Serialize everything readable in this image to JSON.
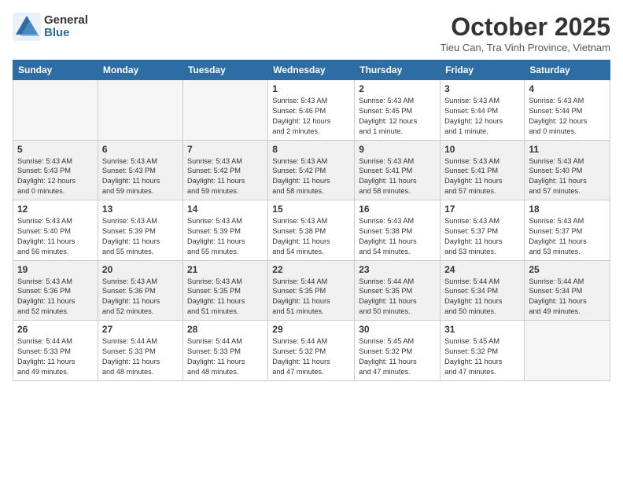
{
  "logo": {
    "general": "General",
    "blue": "Blue"
  },
  "title": "October 2025",
  "location": "Tieu Can, Tra Vinh Province, Vietnam",
  "days_header": [
    "Sunday",
    "Monday",
    "Tuesday",
    "Wednesday",
    "Thursday",
    "Friday",
    "Saturday"
  ],
  "weeks": [
    [
      {
        "num": "",
        "info": ""
      },
      {
        "num": "",
        "info": ""
      },
      {
        "num": "",
        "info": ""
      },
      {
        "num": "1",
        "info": "Sunrise: 5:43 AM\nSunset: 5:46 PM\nDaylight: 12 hours\nand 2 minutes."
      },
      {
        "num": "2",
        "info": "Sunrise: 5:43 AM\nSunset: 5:45 PM\nDaylight: 12 hours\nand 1 minute."
      },
      {
        "num": "3",
        "info": "Sunrise: 5:43 AM\nSunset: 5:44 PM\nDaylight: 12 hours\nand 1 minute."
      },
      {
        "num": "4",
        "info": "Sunrise: 5:43 AM\nSunset: 5:44 PM\nDaylight: 12 hours\nand 0 minutes."
      }
    ],
    [
      {
        "num": "5",
        "info": "Sunrise: 5:43 AM\nSunset: 5:43 PM\nDaylight: 12 hours\nand 0 minutes."
      },
      {
        "num": "6",
        "info": "Sunrise: 5:43 AM\nSunset: 5:43 PM\nDaylight: 11 hours\nand 59 minutes."
      },
      {
        "num": "7",
        "info": "Sunrise: 5:43 AM\nSunset: 5:42 PM\nDaylight: 11 hours\nand 59 minutes."
      },
      {
        "num": "8",
        "info": "Sunrise: 5:43 AM\nSunset: 5:42 PM\nDaylight: 11 hours\nand 58 minutes."
      },
      {
        "num": "9",
        "info": "Sunrise: 5:43 AM\nSunset: 5:41 PM\nDaylight: 11 hours\nand 58 minutes."
      },
      {
        "num": "10",
        "info": "Sunrise: 5:43 AM\nSunset: 5:41 PM\nDaylight: 11 hours\nand 57 minutes."
      },
      {
        "num": "11",
        "info": "Sunrise: 5:43 AM\nSunset: 5:40 PM\nDaylight: 11 hours\nand 57 minutes."
      }
    ],
    [
      {
        "num": "12",
        "info": "Sunrise: 5:43 AM\nSunset: 5:40 PM\nDaylight: 11 hours\nand 56 minutes."
      },
      {
        "num": "13",
        "info": "Sunrise: 5:43 AM\nSunset: 5:39 PM\nDaylight: 11 hours\nand 55 minutes."
      },
      {
        "num": "14",
        "info": "Sunrise: 5:43 AM\nSunset: 5:39 PM\nDaylight: 11 hours\nand 55 minutes."
      },
      {
        "num": "15",
        "info": "Sunrise: 5:43 AM\nSunset: 5:38 PM\nDaylight: 11 hours\nand 54 minutes."
      },
      {
        "num": "16",
        "info": "Sunrise: 5:43 AM\nSunset: 5:38 PM\nDaylight: 11 hours\nand 54 minutes."
      },
      {
        "num": "17",
        "info": "Sunrise: 5:43 AM\nSunset: 5:37 PM\nDaylight: 11 hours\nand 53 minutes."
      },
      {
        "num": "18",
        "info": "Sunrise: 5:43 AM\nSunset: 5:37 PM\nDaylight: 11 hours\nand 53 minutes."
      }
    ],
    [
      {
        "num": "19",
        "info": "Sunrise: 5:43 AM\nSunset: 5:36 PM\nDaylight: 11 hours\nand 52 minutes."
      },
      {
        "num": "20",
        "info": "Sunrise: 5:43 AM\nSunset: 5:36 PM\nDaylight: 11 hours\nand 52 minutes."
      },
      {
        "num": "21",
        "info": "Sunrise: 5:43 AM\nSunset: 5:35 PM\nDaylight: 11 hours\nand 51 minutes."
      },
      {
        "num": "22",
        "info": "Sunrise: 5:44 AM\nSunset: 5:35 PM\nDaylight: 11 hours\nand 51 minutes."
      },
      {
        "num": "23",
        "info": "Sunrise: 5:44 AM\nSunset: 5:35 PM\nDaylight: 11 hours\nand 50 minutes."
      },
      {
        "num": "24",
        "info": "Sunrise: 5:44 AM\nSunset: 5:34 PM\nDaylight: 11 hours\nand 50 minutes."
      },
      {
        "num": "25",
        "info": "Sunrise: 5:44 AM\nSunset: 5:34 PM\nDaylight: 11 hours\nand 49 minutes."
      }
    ],
    [
      {
        "num": "26",
        "info": "Sunrise: 5:44 AM\nSunset: 5:33 PM\nDaylight: 11 hours\nand 49 minutes."
      },
      {
        "num": "27",
        "info": "Sunrise: 5:44 AM\nSunset: 5:33 PM\nDaylight: 11 hours\nand 48 minutes."
      },
      {
        "num": "28",
        "info": "Sunrise: 5:44 AM\nSunset: 5:33 PM\nDaylight: 11 hours\nand 48 minutes."
      },
      {
        "num": "29",
        "info": "Sunrise: 5:44 AM\nSunset: 5:32 PM\nDaylight: 11 hours\nand 47 minutes."
      },
      {
        "num": "30",
        "info": "Sunrise: 5:45 AM\nSunset: 5:32 PM\nDaylight: 11 hours\nand 47 minutes."
      },
      {
        "num": "31",
        "info": "Sunrise: 5:45 AM\nSunset: 5:32 PM\nDaylight: 11 hours\nand 47 minutes."
      },
      {
        "num": "",
        "info": ""
      }
    ]
  ]
}
